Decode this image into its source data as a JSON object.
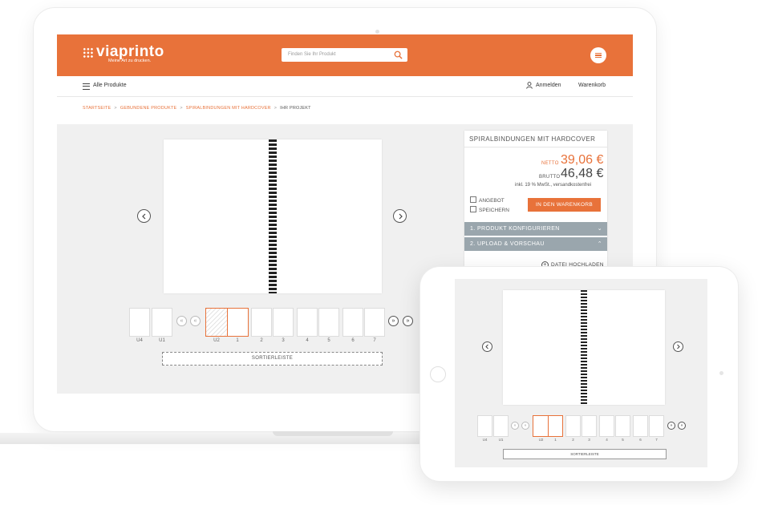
{
  "brand": {
    "name": "viaprinto",
    "tagline": "Meine Art zu drucken."
  },
  "colors": {
    "accent": "#e8723a",
    "accordion": "#9aa6ad",
    "workarea": "#f0f0f0"
  },
  "search": {
    "placeholder": "Finden Sie Ihr Produkt",
    "icon": "search-icon"
  },
  "nav": {
    "all_products": "Alle Produkte",
    "login": "Anmelden",
    "cart": "Warenkorb"
  },
  "breadcrumb": {
    "items": [
      "STARTSEITE",
      "GEBUNDENE PRODUKTE",
      "SPIRALBINDUNGEN MIT HARDCOVER"
    ],
    "current": "IHR PROJEKT",
    "separator": ">"
  },
  "product": {
    "title": "SPIRALBINDUNGEN MIT HARDCOVER",
    "netto_label": "NETTO",
    "netto_price": "39,06 €",
    "brutto_label": "BRUTTO",
    "brutto_price": "46,48 €",
    "tax_note": "inkl. 19 % MwSt., versandkostenfrei",
    "offer": "ANGEBOT",
    "save": "SPEICHERN",
    "add_to_cart": "IN DEN WARENKORB",
    "step1": "1. PRODUKT KONFIGURIEREN",
    "step2": "2. UPLOAD & VORSCHAU",
    "upload": "DATEI HOCHLADEN"
  },
  "editor": {
    "thumbs": {
      "u4": "U4",
      "u1": "U1",
      "u2": "U2",
      "p1": "1",
      "p2": "2",
      "p3": "3",
      "p4": "4",
      "p5": "5",
      "p6": "6",
      "p7": "7"
    },
    "first": "«",
    "prev_page": "«",
    "next_page": "»",
    "last": "»",
    "sorter": "SORTIERLEISTE"
  }
}
